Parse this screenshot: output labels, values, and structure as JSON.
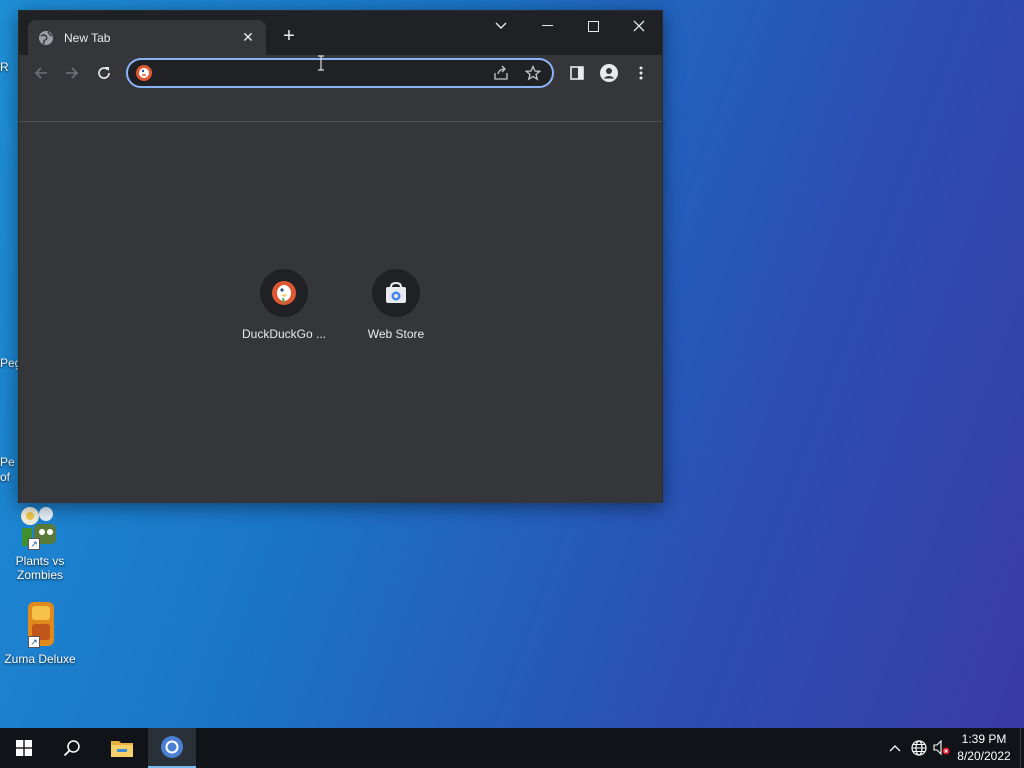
{
  "desktop": {
    "icons": [
      {
        "name": "plants-vs-zombies",
        "label_line1": "Plants vs",
        "label_line2": "Zombies"
      },
      {
        "name": "zuma-deluxe",
        "label_line1": "Zuma Deluxe",
        "label_line2": ""
      }
    ],
    "edge_fragments": [
      "R",
      "Peg",
      "Pe",
      "of"
    ]
  },
  "browser": {
    "tab": {
      "title": "New Tab",
      "close_glyph": "✕"
    },
    "new_tab_glyph": "+",
    "omnibox": {
      "value": "",
      "placeholder": ""
    },
    "shortcuts": [
      {
        "label": "DuckDuckGo ..."
      },
      {
        "label": "Web Store"
      }
    ]
  },
  "taskbar": {
    "clock_time": "1:39 PM",
    "clock_date": "8/20/2022"
  },
  "colors": {
    "accent": "#8ab4f8",
    "window_bg": "#35363a",
    "titlebar_bg": "#202124",
    "ddg_orange": "#de5833"
  },
  "icons": [
    "globe-icon",
    "close-icon",
    "plus-icon",
    "chevron-down-icon",
    "minimize-icon",
    "maximize-icon",
    "back-icon",
    "forward-icon",
    "reload-icon",
    "share-icon",
    "star-icon",
    "side-panel-icon",
    "profile-icon",
    "more-icon",
    "windows-start-icon",
    "search-icon",
    "file-explorer-icon",
    "chrome-icon",
    "chevron-up-icon",
    "network-icon",
    "volume-muted-icon"
  ]
}
